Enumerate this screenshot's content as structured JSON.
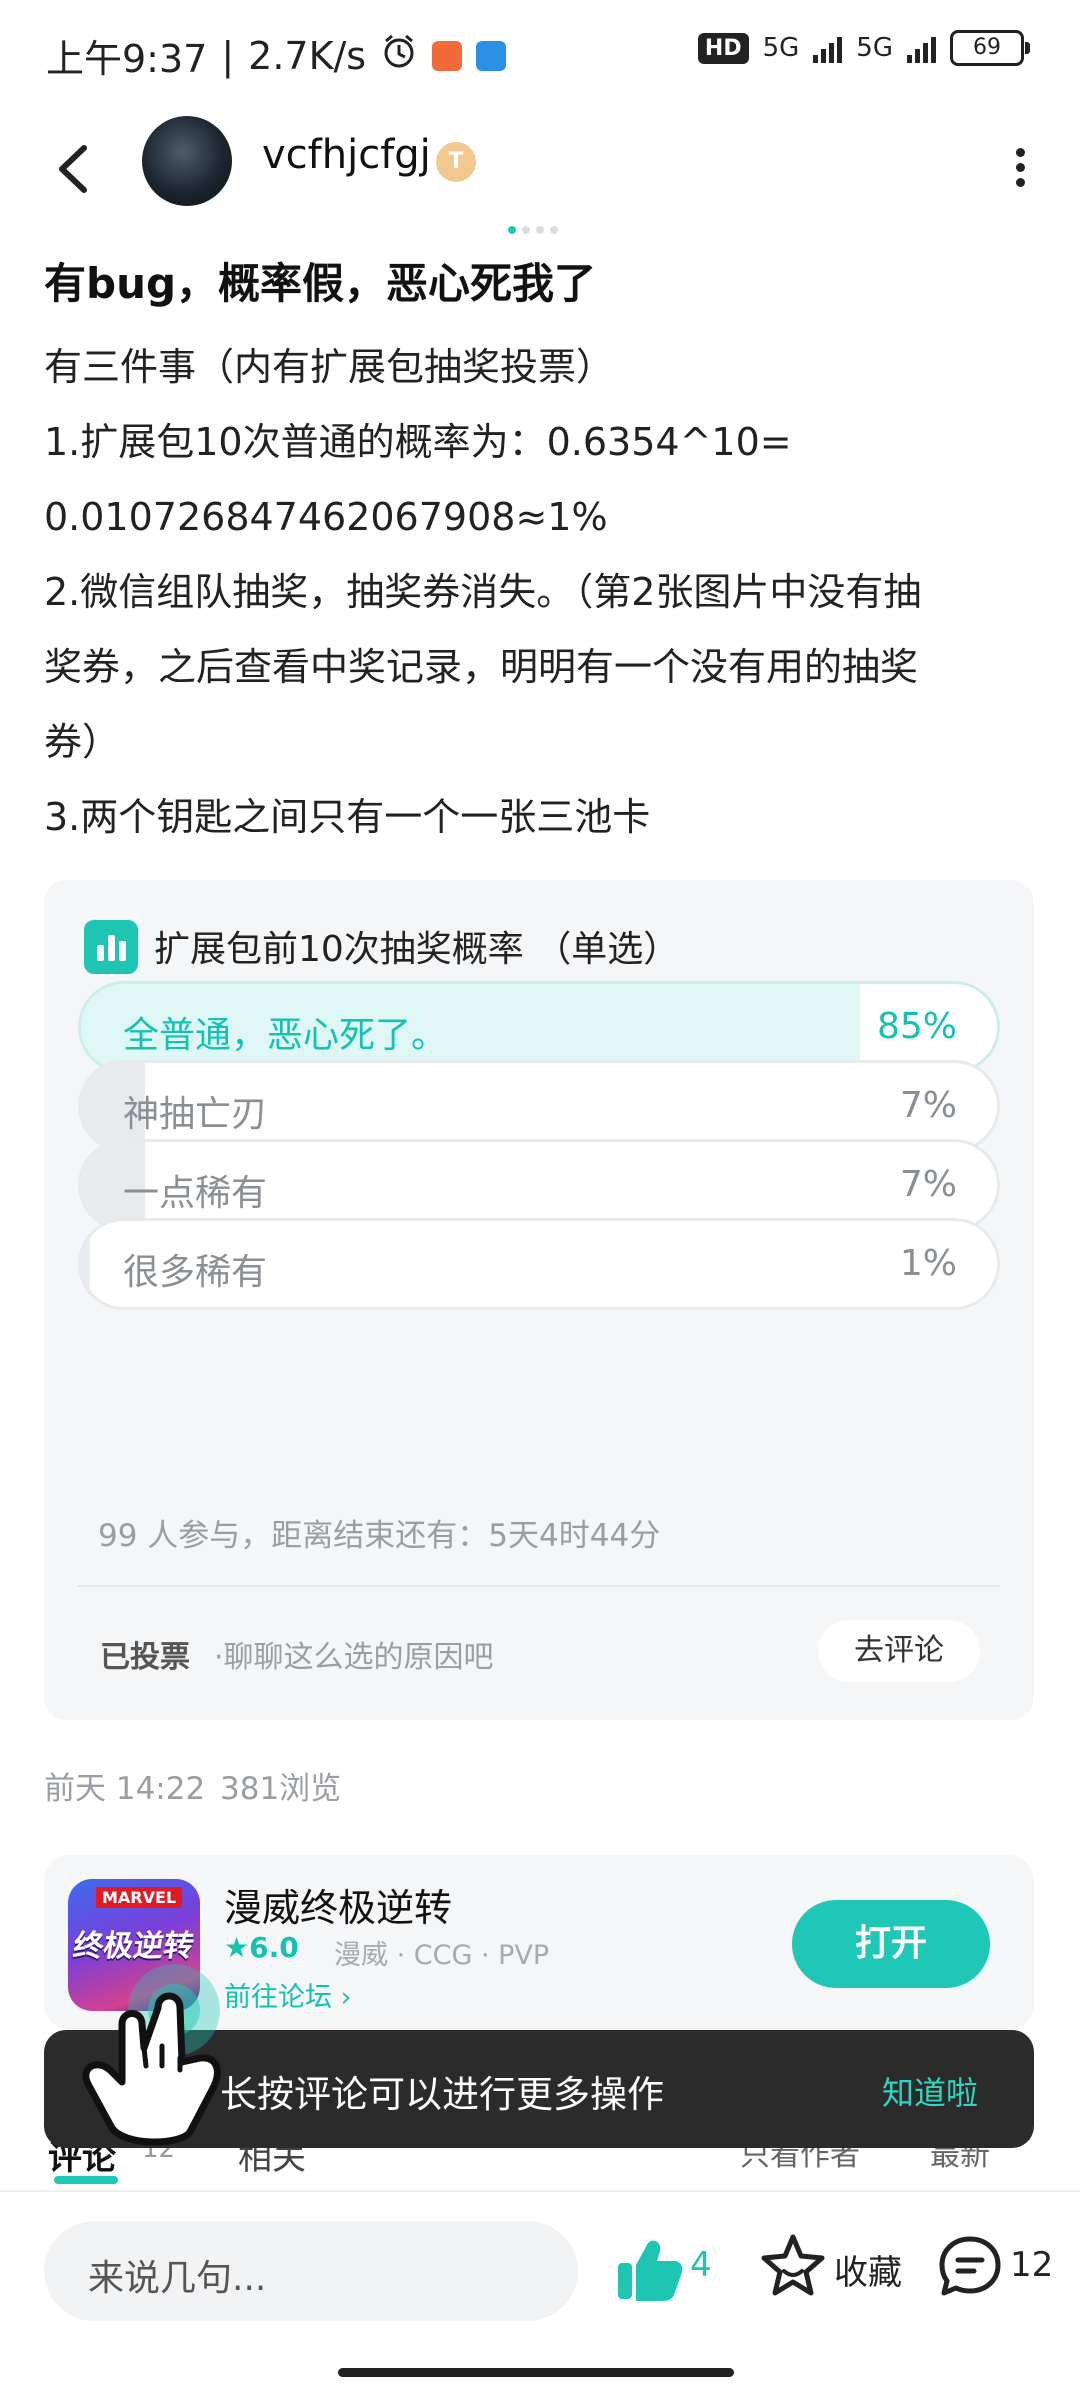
{
  "status_bar": {
    "time": "上午9:37",
    "net_speed": "2.7K/s",
    "hd_label": "HD",
    "signal1_label": "5G",
    "signal2_label": "5G",
    "battery": "69"
  },
  "header": {
    "author": "vcfhjcfgj",
    "badge": "T"
  },
  "post": {
    "title": "有bug，概率假，恶心死我了",
    "lines": [
      "有三件事（内有扩展包抽奖投票）",
      "1.扩展包10次普通的概率为：0.6354^10=",
      "0.010726847462067908≈1%",
      "2.微信组队抽奖，抽奖券消失。（第2张图片中没有抽",
      "奖券，之后查看中奖记录，明明有一个没有用的抽奖",
      "券）",
      "3.两个钥匙之间只有一个一张三池卡"
    ],
    "time": "前天 14:22",
    "views": "381浏览"
  },
  "poll": {
    "title": "扩展包前10次抽奖概率 （单选）",
    "options": [
      {
        "label": "全普通，恶心死了。",
        "pct": "85%",
        "share": 0.85
      },
      {
        "label": "神抽亡刃",
        "pct": "7%",
        "share": 0.07
      },
      {
        "label": "一点稀有",
        "pct": "7%",
        "share": 0.07
      },
      {
        "label": "很多稀有",
        "pct": "1%",
        "share": 0.01
      }
    ],
    "meta": "99 人参与，距离结束还有：5天4时44分",
    "voted": "已投票",
    "hint": "·聊聊这么选的原因吧",
    "comment_btn": "去评论"
  },
  "game": {
    "name": "漫威终极逆转",
    "icon_brand": "MARVEL",
    "icon_title": "终极逆转",
    "rating": "★6.0",
    "tags": "漫威 · CCG · PVP",
    "forum": "前往论坛 ›",
    "open": "打开"
  },
  "tabs": {
    "comment": "评论",
    "comment_count": "12",
    "related": "相关",
    "author_only": "只看作者",
    "sort": "最新"
  },
  "toast": {
    "text": "长按评论可以进行更多操作",
    "ok": "知道啦"
  },
  "bottom": {
    "placeholder": "来说几句...",
    "likes": "4",
    "favorite": "收藏",
    "comments": "12"
  },
  "colors": {
    "accent": "#1fc8b6",
    "toast_bg": "#2b2b2b"
  }
}
